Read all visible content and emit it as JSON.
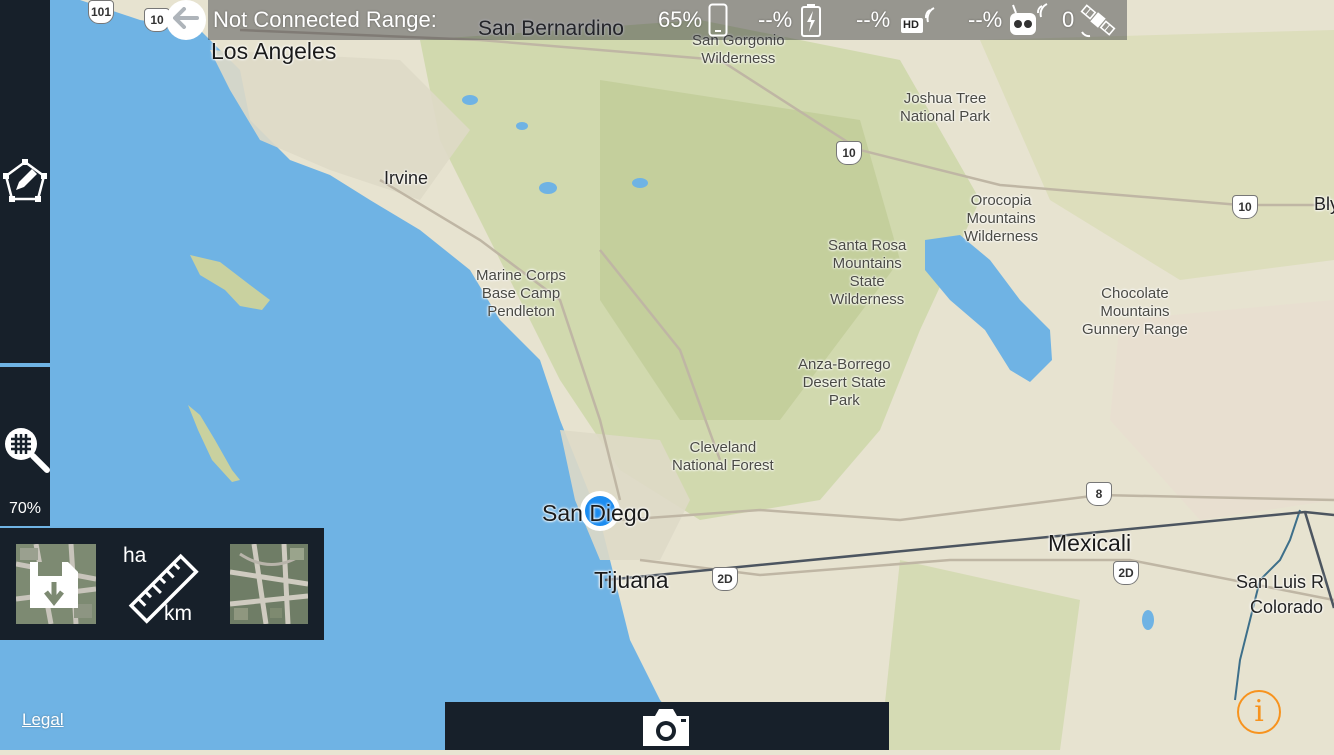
{
  "status_bar": {
    "connection_text": "Not Connected Range:",
    "device_battery": "65%",
    "drone_battery": "--%",
    "hd_signal": "--%",
    "rc_signal": "--%",
    "satellites": "0",
    "hd_badge": "HD"
  },
  "map": {
    "city_labels": [
      "Los Angeles",
      "San Bernardino",
      "Irvine",
      "San Diego",
      "Tijuana",
      "Mexicali"
    ],
    "region_labels": [
      "San Gorgonio\nWilderness",
      "Joshua Tree\nNational Park",
      "Orocopia\nMountains\nWilderness",
      "Santa Rosa\nMountains\nState\nWilderness",
      "Chocolate\nMountains\nGunnery Range",
      "Marine Corps\nBase Camp\nPendleton",
      "Anza-Borrego\nDesert State\nPark",
      "Cleveland\nNational Forest"
    ],
    "edge_labels": [
      "Bly",
      "San Luis R",
      "Colorado"
    ],
    "highway_shields": [
      "101",
      "10",
      "10",
      "10",
      "8",
      "2D",
      "2D"
    ]
  },
  "sidebar": {
    "zoom_percent": "70%"
  },
  "tools": {
    "area_unit": "ha",
    "length_unit": "km"
  },
  "footer": {
    "legal_label": "Legal",
    "info_symbol": "i"
  },
  "colors": {
    "water": "#6fb3e4",
    "land": "#e6e3cf",
    "vegetation": "#c8d3a3",
    "panel": "#17202a",
    "location_dot": "#1c8cf0",
    "info_accent": "#f7931e",
    "flight_line": "#4c5560"
  },
  "icons": {
    "back": "back-arrow-icon",
    "device": "phone-icon",
    "battery": "battery-icon",
    "hd": "hd-signal-icon",
    "rc": "remote-controller-icon",
    "satellite": "satellite-icon",
    "area_tool": "polygon-edit-icon",
    "zoom_grid": "grid-zoom-icon",
    "save_offline": "save-offline-map-icon",
    "measure": "ruler-icon",
    "satellite_view": "satellite-map-icon",
    "camera": "camera-icon",
    "info": "info-icon"
  }
}
